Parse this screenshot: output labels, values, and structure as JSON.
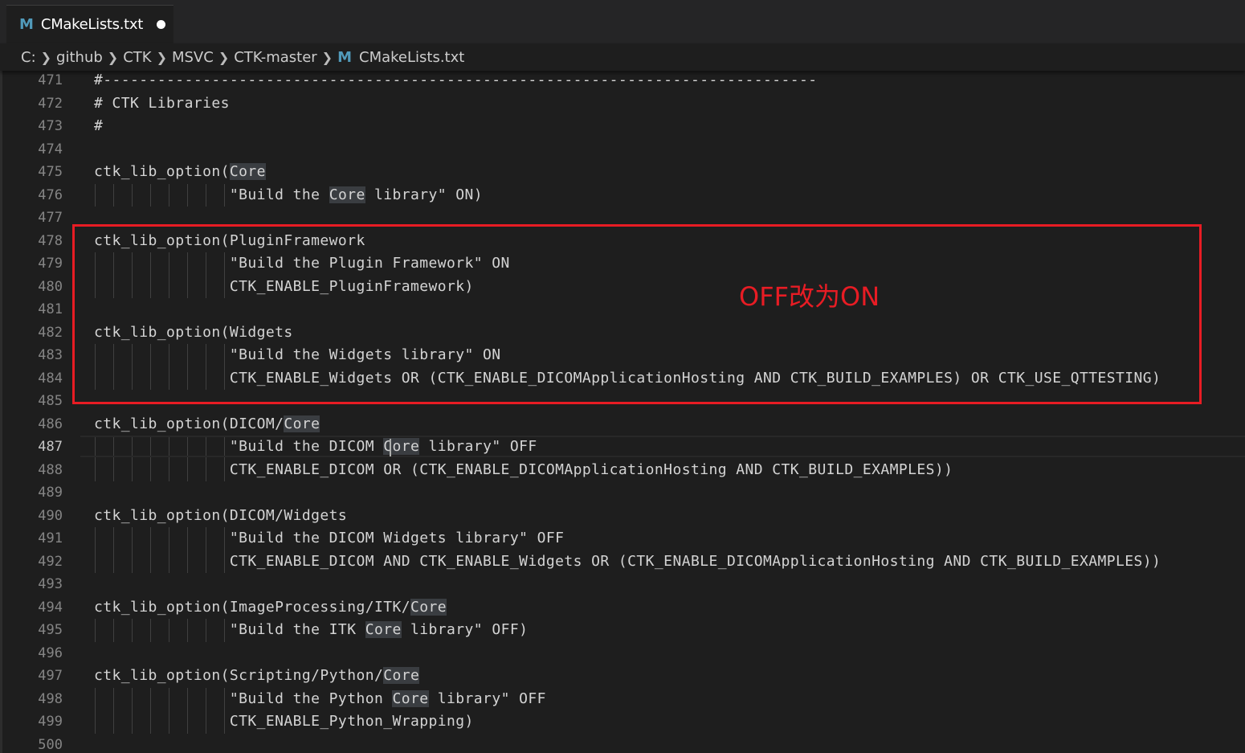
{
  "tab": {
    "title": "CMakeLists.txt",
    "icon": "M"
  },
  "breadcrumb": [
    "C:",
    "github",
    "CTK",
    "MSVC",
    "CTK-master"
  ],
  "breadcrumb_file": {
    "icon": "M",
    "name": "CMakeLists.txt"
  },
  "annotation": {
    "text": "OFF改为ON"
  },
  "lines": [
    {
      "n": "471",
      "t": "#-------------------------------------------------------------------------------"
    },
    {
      "n": "472",
      "t": "# CTK Libraries"
    },
    {
      "n": "473",
      "t": "#"
    },
    {
      "n": "474",
      "t": ""
    },
    {
      "n": "475",
      "t": "ctk_lib_option(Core"
    },
    {
      "n": "476",
      "t": "               \"Build the Core library\" ON)"
    },
    {
      "n": "477",
      "t": ""
    },
    {
      "n": "478",
      "t": "ctk_lib_option(PluginFramework"
    },
    {
      "n": "479",
      "t": "               \"Build the Plugin Framework\" ON"
    },
    {
      "n": "480",
      "t": "               CTK_ENABLE_PluginFramework)"
    },
    {
      "n": "481",
      "t": ""
    },
    {
      "n": "482",
      "t": "ctk_lib_option(Widgets"
    },
    {
      "n": "483",
      "t": "               \"Build the Widgets library\" ON"
    },
    {
      "n": "484",
      "t": "               CTK_ENABLE_Widgets OR (CTK_ENABLE_DICOMApplicationHosting AND CTK_BUILD_EXAMPLES) OR CTK_USE_QTTESTING)"
    },
    {
      "n": "485",
      "t": ""
    },
    {
      "n": "486",
      "t": "ctk_lib_option(DICOM/Core"
    },
    {
      "n": "487",
      "t": "               \"Build the DICOM Core library\" OFF"
    },
    {
      "n": "488",
      "t": "               CTK_ENABLE_DICOM OR (CTK_ENABLE_DICOMApplicationHosting AND CTK_BUILD_EXAMPLES))"
    },
    {
      "n": "489",
      "t": ""
    },
    {
      "n": "490",
      "t": "ctk_lib_option(DICOM/Widgets"
    },
    {
      "n": "491",
      "t": "               \"Build the DICOM Widgets library\" OFF"
    },
    {
      "n": "492",
      "t": "               CTK_ENABLE_DICOM AND CTK_ENABLE_Widgets OR (CTK_ENABLE_DICOMApplicationHosting AND CTK_BUILD_EXAMPLES))"
    },
    {
      "n": "493",
      "t": ""
    },
    {
      "n": "494",
      "t": "ctk_lib_option(ImageProcessing/ITK/Core"
    },
    {
      "n": "495",
      "t": "               \"Build the ITK Core library\" OFF)"
    },
    {
      "n": "496",
      "t": ""
    },
    {
      "n": "497",
      "t": "ctk_lib_option(Scripting/Python/Core"
    },
    {
      "n": "498",
      "t": "               \"Build the Python Core library\" OFF"
    },
    {
      "n": "499",
      "t": "               CTK_ENABLE_Python_Wrapping)"
    },
    {
      "n": "500",
      "t": ""
    }
  ],
  "highlight_word": "Core",
  "active_line": "487",
  "colors": {
    "accent_red": "#e81c24",
    "cmake_icon": "#519aba",
    "editor_bg": "#1e1e1e"
  }
}
